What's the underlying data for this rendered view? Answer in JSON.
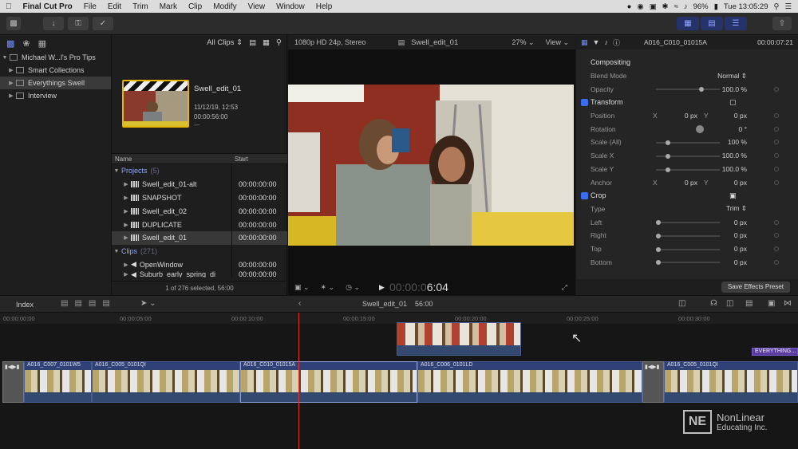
{
  "menubar": {
    "app": "Final Cut Pro",
    "items": [
      "File",
      "Edit",
      "Trim",
      "Mark",
      "Clip",
      "Modify",
      "View",
      "Window",
      "Help"
    ],
    "battery": "96%",
    "clock": "Tue 13:05:29"
  },
  "library": {
    "items": [
      {
        "label": "Michael W...l's Pro Tips",
        "selected": false
      },
      {
        "label": "Smart Collections",
        "selected": false
      },
      {
        "label": "Everythings Swell",
        "selected": true
      },
      {
        "label": "Interview",
        "selected": false
      }
    ]
  },
  "browser": {
    "filter": "All Clips",
    "project_title": "Swell_edit_01",
    "project_date": "11/12/19, 12:53",
    "project_duration": "00:00:56:00",
    "col_name": "Name",
    "col_start": "Start",
    "group_projects": "Projects",
    "projects_count": "(5)",
    "projects": [
      {
        "name": "Swell_edit_01-alt",
        "start": "00:00:00:00"
      },
      {
        "name": "SNAPSHOT",
        "start": "00:00:00:00"
      },
      {
        "name": "Swell_edit_02",
        "start": "00:00:00:00"
      },
      {
        "name": "DUPLICATE",
        "start": "00:00:00:00"
      },
      {
        "name": "Swell_edit_01",
        "start": "00:00:00:00"
      }
    ],
    "group_clips": "Clips",
    "clips_count": "(271)",
    "clips": [
      {
        "name": "OpenWindow",
        "start": "00:00:00:00"
      },
      {
        "name": "Suburb_early_spring_di",
        "start": "00:00:00:00"
      }
    ],
    "status": "1 of 276 selected, 56:00"
  },
  "viewer": {
    "format": "1080p HD 24p, Stereo",
    "title": "Swell_edit_01",
    "zoom": "27%",
    "view_label": "View",
    "timecode_dim": "00:00:0",
    "timecode": "6:04"
  },
  "inspector": {
    "clip_name": "A016_C010_01015A",
    "clip_time": "00:00:07:21",
    "compositing": "Compositing",
    "blend_mode_label": "Blend Mode",
    "blend_mode": "Normal",
    "opacity_label": "Opacity",
    "opacity": "100.0 %",
    "transform": "Transform",
    "position_label": "Position",
    "pos_x_label": "X",
    "pos_x": "0 px",
    "pos_y_label": "Y",
    "pos_y": "0 px",
    "rotation_label": "Rotation",
    "rotation": "0 °",
    "scale_all_label": "Scale (All)",
    "scale_all": "100 %",
    "scale_x_label": "Scale X",
    "scale_x": "100.0 %",
    "scale_y_label": "Scale Y",
    "scale_y": "100.0 %",
    "anchor_label": "Anchor",
    "anchor_x_label": "X",
    "anchor_x": "0 px",
    "anchor_y_label": "Y",
    "anchor_y": "0 px",
    "crop": "Crop",
    "crop_type_label": "Type",
    "crop_type": "Trim",
    "left_label": "Left",
    "left": "0 px",
    "right_label": "Right",
    "right": "0 px",
    "top_label": "Top",
    "top": "0 px",
    "bottom_label": "Bottom",
    "bottom": "0 px",
    "save_preset": "Save Effects Preset"
  },
  "timeline": {
    "index": "Index",
    "project": "Swell_edit_01",
    "duration": "56:00",
    "ruler": [
      "00:00:00:00",
      "00:00:05:00",
      "00:00:10:00",
      "00:00:15:00",
      "00:00:20:00",
      "00:00:25:00",
      "00:00:30:00"
    ],
    "clips": [
      "A016_C007_0101W5",
      "A016_C005_0101QI",
      "A016_C010_01015A",
      "A016_C006_0101LD",
      "A016_C005_0101QI"
    ],
    "connected_label": "EVERYTHING..."
  },
  "watermark": {
    "line1": "NonLinear",
    "line2": "Educating Inc."
  },
  "colors": {
    "accent": "#3c6df0",
    "playhead": "#e03030",
    "selection": "#e8b200"
  }
}
